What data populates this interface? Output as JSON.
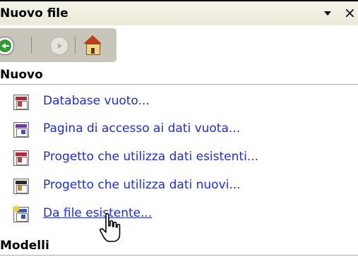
{
  "panel": {
    "title": "Nuovo file",
    "menu_icon": "chevron-down-icon",
    "close_glyph": "×"
  },
  "toolbar": {
    "buttons": [
      {
        "name": "back",
        "icon": "back-arrow-icon",
        "enabled": true
      },
      {
        "name": "forward",
        "icon": "forward-arrow-icon",
        "enabled": false
      },
      {
        "name": "home",
        "icon": "home-icon",
        "enabled": true
      }
    ]
  },
  "sections": {
    "new": {
      "title": "Nuovo",
      "items": [
        {
          "label": "Database vuoto...",
          "icon": "blank-database-icon"
        },
        {
          "label": "Pagina di accesso ai dati vuota...",
          "icon": "data-access-page-icon"
        },
        {
          "label": "Progetto che utilizza dati esistenti...",
          "icon": "project-existing-data-icon"
        },
        {
          "label": "Progetto che utilizza dati nuovi...",
          "icon": "project-new-data-icon"
        },
        {
          "label": "Da file esistente...",
          "icon": "from-existing-file-icon",
          "hover": true
        }
      ]
    },
    "templates": {
      "title": "Modelli"
    }
  },
  "colors": {
    "link": "#1f2fc8",
    "header_bg": "#ece9d8",
    "toolbar_bg": "#c8c5bb"
  }
}
